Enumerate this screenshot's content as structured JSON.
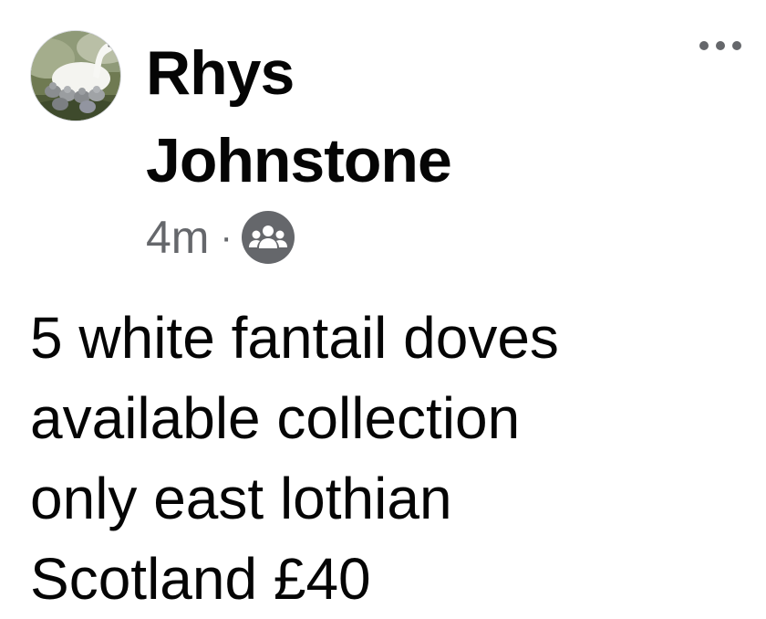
{
  "post": {
    "author": {
      "name": "Rhys Johnstone",
      "avatar_icon": "swan-with-cygnets-avatar"
    },
    "timestamp": "4m",
    "separator": "·",
    "audience_icon": "group-members-icon",
    "more_icon": "more-options-icon",
    "text": "5 white fantail doves\navailable collection\nonly east lothian\nScotland £40"
  },
  "colors": {
    "primary_text": "#050505",
    "secondary_text": "#65676b",
    "icon_grey": "#65676b",
    "background": "#ffffff"
  }
}
